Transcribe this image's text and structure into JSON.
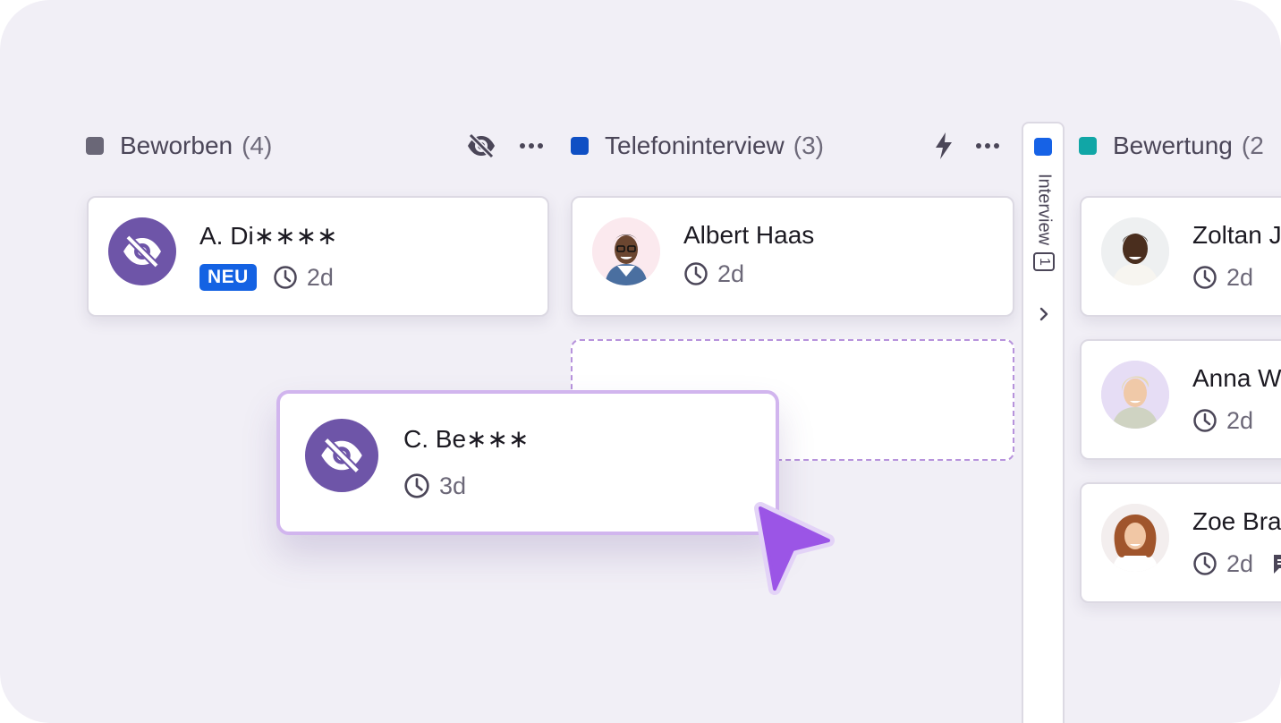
{
  "columns": [
    {
      "id": "beworben",
      "title": "Beworben",
      "count": "(4)",
      "color": "#6a6777"
    },
    {
      "id": "telefon",
      "title": "Telefoninterview",
      "count": "(3)",
      "color": "#0f4fc4"
    },
    {
      "id": "bewertung",
      "title": "Bewertung",
      "count": "(2",
      "color": "#11a6a6"
    }
  ],
  "collapsed_column": {
    "label": "Interview",
    "count": "1",
    "color": "#1662e6"
  },
  "cards": {
    "a_di": {
      "name": "A. Di∗∗∗∗",
      "badge": "NEU",
      "time": "2d"
    },
    "albert": {
      "name": "Albert Haas",
      "time": "2d"
    },
    "zoltan": {
      "name": "Zoltan J",
      "time": "2d"
    },
    "anna": {
      "name": "Anna W",
      "time": "2d"
    },
    "zoe": {
      "name": "Zoe Bra",
      "time": "2d"
    }
  },
  "dragging_card": {
    "name": "C. Be∗∗∗",
    "time": "3d"
  },
  "icons": {
    "beworben_visibility": "eye-off-icon",
    "beworben_more": "more-horizontal-icon",
    "telefon_automation": "lightning-icon",
    "telefon_more": "more-horizontal-icon",
    "clock": "clock-icon",
    "comment": "comment-icon",
    "cursor": "mouse-cursor-icon"
  }
}
